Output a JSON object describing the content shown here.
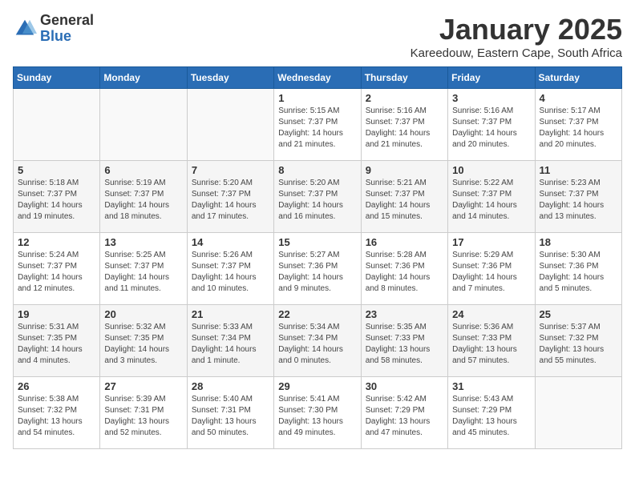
{
  "header": {
    "logo_general": "General",
    "logo_blue": "Blue",
    "month": "January 2025",
    "location": "Kareedouw, Eastern Cape, South Africa"
  },
  "weekdays": [
    "Sunday",
    "Monday",
    "Tuesday",
    "Wednesday",
    "Thursday",
    "Friday",
    "Saturday"
  ],
  "weeks": [
    [
      {
        "day": "",
        "info": ""
      },
      {
        "day": "",
        "info": ""
      },
      {
        "day": "",
        "info": ""
      },
      {
        "day": "1",
        "info": "Sunrise: 5:15 AM\nSunset: 7:37 PM\nDaylight: 14 hours\nand 21 minutes."
      },
      {
        "day": "2",
        "info": "Sunrise: 5:16 AM\nSunset: 7:37 PM\nDaylight: 14 hours\nand 21 minutes."
      },
      {
        "day": "3",
        "info": "Sunrise: 5:16 AM\nSunset: 7:37 PM\nDaylight: 14 hours\nand 20 minutes."
      },
      {
        "day": "4",
        "info": "Sunrise: 5:17 AM\nSunset: 7:37 PM\nDaylight: 14 hours\nand 20 minutes."
      }
    ],
    [
      {
        "day": "5",
        "info": "Sunrise: 5:18 AM\nSunset: 7:37 PM\nDaylight: 14 hours\nand 19 minutes."
      },
      {
        "day": "6",
        "info": "Sunrise: 5:19 AM\nSunset: 7:37 PM\nDaylight: 14 hours\nand 18 minutes."
      },
      {
        "day": "7",
        "info": "Sunrise: 5:20 AM\nSunset: 7:37 PM\nDaylight: 14 hours\nand 17 minutes."
      },
      {
        "day": "8",
        "info": "Sunrise: 5:20 AM\nSunset: 7:37 PM\nDaylight: 14 hours\nand 16 minutes."
      },
      {
        "day": "9",
        "info": "Sunrise: 5:21 AM\nSunset: 7:37 PM\nDaylight: 14 hours\nand 15 minutes."
      },
      {
        "day": "10",
        "info": "Sunrise: 5:22 AM\nSunset: 7:37 PM\nDaylight: 14 hours\nand 14 minutes."
      },
      {
        "day": "11",
        "info": "Sunrise: 5:23 AM\nSunset: 7:37 PM\nDaylight: 14 hours\nand 13 minutes."
      }
    ],
    [
      {
        "day": "12",
        "info": "Sunrise: 5:24 AM\nSunset: 7:37 PM\nDaylight: 14 hours\nand 12 minutes."
      },
      {
        "day": "13",
        "info": "Sunrise: 5:25 AM\nSunset: 7:37 PM\nDaylight: 14 hours\nand 11 minutes."
      },
      {
        "day": "14",
        "info": "Sunrise: 5:26 AM\nSunset: 7:37 PM\nDaylight: 14 hours\nand 10 minutes."
      },
      {
        "day": "15",
        "info": "Sunrise: 5:27 AM\nSunset: 7:36 PM\nDaylight: 14 hours\nand 9 minutes."
      },
      {
        "day": "16",
        "info": "Sunrise: 5:28 AM\nSunset: 7:36 PM\nDaylight: 14 hours\nand 8 minutes."
      },
      {
        "day": "17",
        "info": "Sunrise: 5:29 AM\nSunset: 7:36 PM\nDaylight: 14 hours\nand 7 minutes."
      },
      {
        "day": "18",
        "info": "Sunrise: 5:30 AM\nSunset: 7:36 PM\nDaylight: 14 hours\nand 5 minutes."
      }
    ],
    [
      {
        "day": "19",
        "info": "Sunrise: 5:31 AM\nSunset: 7:35 PM\nDaylight: 14 hours\nand 4 minutes."
      },
      {
        "day": "20",
        "info": "Sunrise: 5:32 AM\nSunset: 7:35 PM\nDaylight: 14 hours\nand 3 minutes."
      },
      {
        "day": "21",
        "info": "Sunrise: 5:33 AM\nSunset: 7:34 PM\nDaylight: 14 hours\nand 1 minute."
      },
      {
        "day": "22",
        "info": "Sunrise: 5:34 AM\nSunset: 7:34 PM\nDaylight: 14 hours\nand 0 minutes."
      },
      {
        "day": "23",
        "info": "Sunrise: 5:35 AM\nSunset: 7:33 PM\nDaylight: 13 hours\nand 58 minutes."
      },
      {
        "day": "24",
        "info": "Sunrise: 5:36 AM\nSunset: 7:33 PM\nDaylight: 13 hours\nand 57 minutes."
      },
      {
        "day": "25",
        "info": "Sunrise: 5:37 AM\nSunset: 7:32 PM\nDaylight: 13 hours\nand 55 minutes."
      }
    ],
    [
      {
        "day": "26",
        "info": "Sunrise: 5:38 AM\nSunset: 7:32 PM\nDaylight: 13 hours\nand 54 minutes."
      },
      {
        "day": "27",
        "info": "Sunrise: 5:39 AM\nSunset: 7:31 PM\nDaylight: 13 hours\nand 52 minutes."
      },
      {
        "day": "28",
        "info": "Sunrise: 5:40 AM\nSunset: 7:31 PM\nDaylight: 13 hours\nand 50 minutes."
      },
      {
        "day": "29",
        "info": "Sunrise: 5:41 AM\nSunset: 7:30 PM\nDaylight: 13 hours\nand 49 minutes."
      },
      {
        "day": "30",
        "info": "Sunrise: 5:42 AM\nSunset: 7:29 PM\nDaylight: 13 hours\nand 47 minutes."
      },
      {
        "day": "31",
        "info": "Sunrise: 5:43 AM\nSunset: 7:29 PM\nDaylight: 13 hours\nand 45 minutes."
      },
      {
        "day": "",
        "info": ""
      }
    ]
  ]
}
